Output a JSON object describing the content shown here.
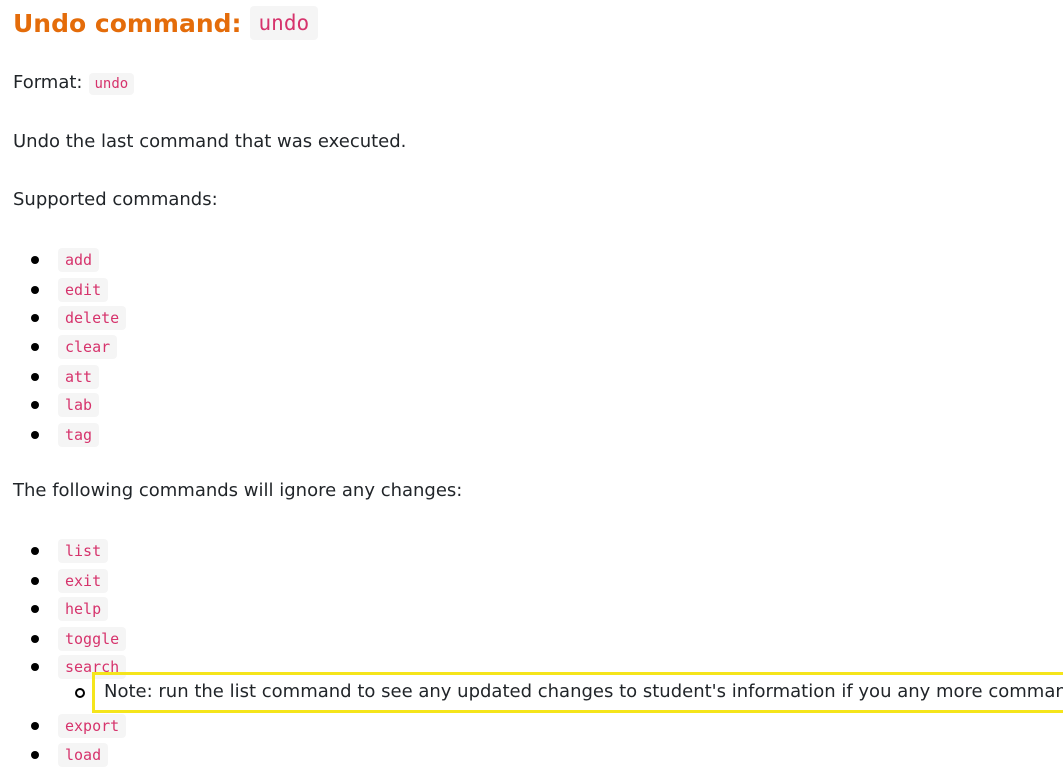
{
  "heading": {
    "title": "Undo command:",
    "command": "undo"
  },
  "format": {
    "label": "Format:",
    "command": "undo"
  },
  "description": "Undo the last command that was executed.",
  "supported": {
    "label": "Supported commands:",
    "items": [
      "add",
      "edit",
      "delete",
      "clear",
      "att",
      "lab",
      "tag"
    ]
  },
  "ignored": {
    "label": "The following commands will ignore any changes:",
    "items": [
      "list",
      "exit",
      "help",
      "toggle",
      "search",
      "export",
      "load"
    ],
    "note": "Note: run the list command to see any updated changes to student's information if you any more commands."
  },
  "colors": {
    "heading": "#e46c0a",
    "code_text": "#d6336c",
    "code_bg": "#f5f5f5",
    "highlight_border": "#f5e51b"
  }
}
